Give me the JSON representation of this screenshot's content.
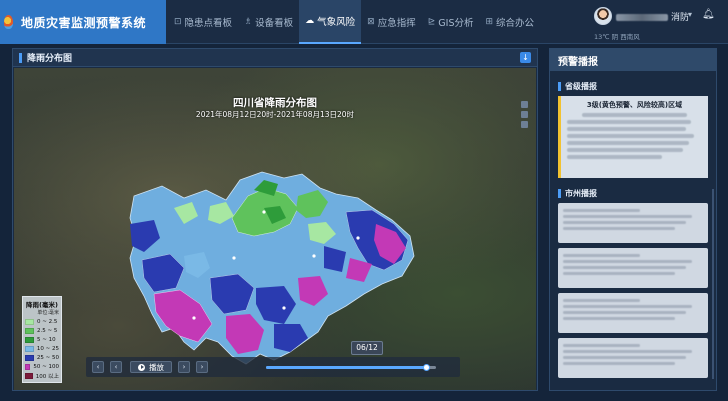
{
  "app": {
    "title": "地质灾害监测预警系统"
  },
  "nav": [
    {
      "label": "隐患点看板",
      "icon": "monitor-icon",
      "glyph": "⊡",
      "active": false
    },
    {
      "label": "设备看板",
      "icon": "device-icon",
      "glyph": "♗",
      "active": false
    },
    {
      "label": "气象风险",
      "icon": "cloud-icon",
      "glyph": "☁",
      "active": true
    },
    {
      "label": "应急指挥",
      "icon": "command-icon",
      "glyph": "⊠",
      "active": false
    },
    {
      "label": "GIS分析",
      "icon": "gis-icon",
      "glyph": "⊵",
      "active": false
    },
    {
      "label": "综合办公",
      "icon": "office-icon",
      "glyph": "⊞",
      "active": false
    }
  ],
  "user": {
    "name_suffix": "消防",
    "weather": "13℃  阴  西南风"
  },
  "map_panel": {
    "title": "降雨分布图",
    "map_title": "四川省降雨分布图",
    "map_subtitle": "2021年08月12日20时-2021年08月13日20时",
    "legend": {
      "title": "降雨(毫米)",
      "unit": "单位:毫米",
      "items": [
        {
          "label": "0 ~ 2.5",
          "color": "#a7e7a2"
        },
        {
          "label": "2.5 ~ 5",
          "color": "#5fc25c"
        },
        {
          "label": "5 ~ 10",
          "color": "#2e9c3a"
        },
        {
          "label": "10 ~ 25",
          "color": "#7ab9e6"
        },
        {
          "label": "25 ~ 50",
          "color": "#2a3bb0"
        },
        {
          "label": "50 ~ 100",
          "color": "#c339b6"
        },
        {
          "label": "100 以上",
          "color": "#7b1a3a"
        }
      ]
    },
    "player": {
      "play_label": "播放",
      "progress": 0.94,
      "current": "06/12"
    }
  },
  "warning_panel": {
    "title": "预警播报",
    "province_section": "省级播报",
    "province_card_title": "3级(黄色预警、风险较高)区域",
    "city_section": "市州播报"
  },
  "colors": {
    "accent": "#2f77c6",
    "warning_stripe": "#f2c230"
  }
}
